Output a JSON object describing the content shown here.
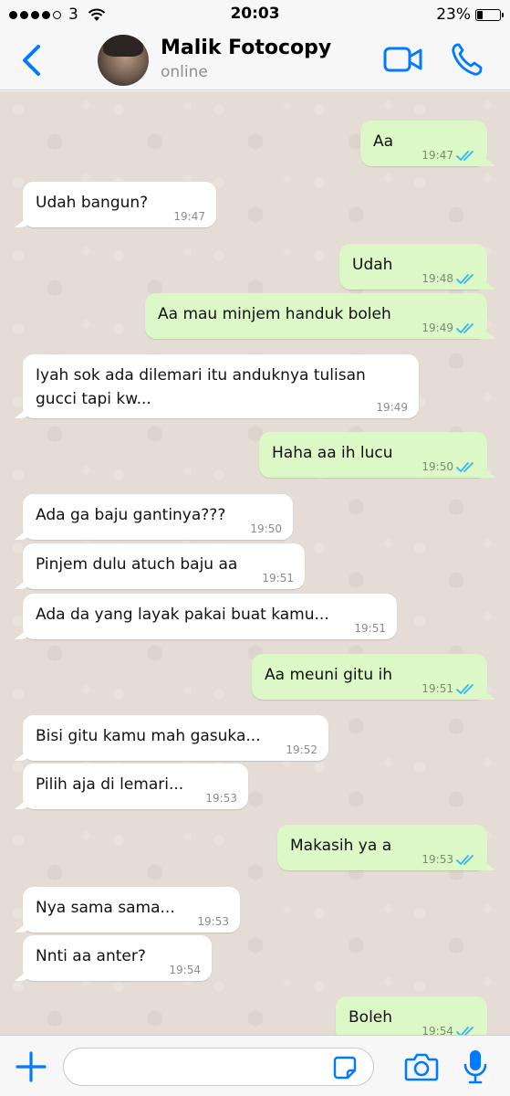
{
  "status_bar": {
    "carrier": "3",
    "time": "20:03",
    "battery": "23%",
    "battery_level": 0.23
  },
  "header": {
    "contact_name": "Malik Fotocopy",
    "contact_status": "online"
  },
  "messages": [
    {
      "dir": "out",
      "text": "Aa",
      "time": "19:47",
      "ticks": "double-check-read-icon"
    },
    {
      "dir": "in",
      "text": "Udah bangun?",
      "time": "19:47"
    },
    {
      "dir": "out",
      "text": "Udah",
      "time": "19:48",
      "ticks": "double-check-read-icon"
    },
    {
      "dir": "out",
      "text": "Aa mau minjem handuk boleh",
      "time": "19:49",
      "ticks": "double-check-read-icon"
    },
    {
      "dir": "in",
      "text": "Iyah sok ada dilemari itu anduknya tulisan gucci tapi kw...",
      "time": "19:49"
    },
    {
      "dir": "out",
      "text": "Haha aa ih lucu",
      "time": "19:50",
      "ticks": "double-check-read-icon"
    },
    {
      "dir": "in",
      "text": "Ada ga baju gantinya???",
      "time": "19:50"
    },
    {
      "dir": "in",
      "text": "Pinjem dulu atuch baju aa",
      "time": "19:51"
    },
    {
      "dir": "in",
      "text": "Ada da yang layak pakai buat kamu...",
      "time": "19:51"
    },
    {
      "dir": "out",
      "text": "Aa meuni gitu ih",
      "time": "19:51",
      "ticks": "double-check-read-icon"
    },
    {
      "dir": "in",
      "text": "Bisi gitu kamu mah gasuka...",
      "time": "19:52"
    },
    {
      "dir": "in",
      "text": "Pilih aja di lemari...",
      "time": "19:53"
    },
    {
      "dir": "out",
      "text": "Makasih ya a",
      "time": "19:53",
      "ticks": "double-check-read-icon"
    },
    {
      "dir": "in",
      "text": "Nya sama sama...",
      "time": "19:53"
    },
    {
      "dir": "in",
      "text": "Nnti aa anter?",
      "time": "19:54"
    },
    {
      "dir": "out",
      "text": "Boleh",
      "time": "19:54",
      "ticks": "double-check-read-icon"
    }
  ],
  "input_bar": {
    "placeholder": ""
  },
  "colors": {
    "accent": "#007aff",
    "bubble_out": "#dcf8c6",
    "bubble_in": "#ffffff",
    "chat_bg": "#e5ddd5",
    "read_ticks": "#34b7f1"
  }
}
